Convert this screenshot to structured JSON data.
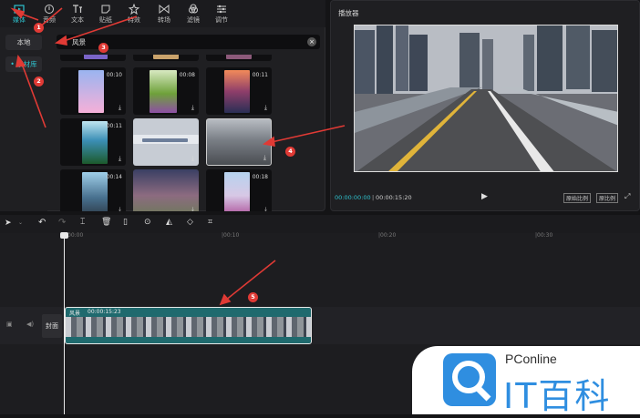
{
  "toolbar": {
    "tabs": [
      {
        "label": "媒体",
        "icon": "media-icon",
        "active": true
      },
      {
        "label": "音频",
        "icon": "audio-icon"
      },
      {
        "label": "文本",
        "icon": "text-icon"
      },
      {
        "label": "贴纸",
        "icon": "sticker-icon"
      },
      {
        "label": "特效",
        "icon": "effects-icon"
      },
      {
        "label": "转场",
        "icon": "transition-icon"
      },
      {
        "label": "滤镜",
        "icon": "filter-icon"
      },
      {
        "label": "调节",
        "icon": "adjust-icon"
      }
    ]
  },
  "sidebar": {
    "items": [
      {
        "label": "本地"
      },
      {
        "label": "• 素材库",
        "active": true
      }
    ]
  },
  "search": {
    "value": "风景"
  },
  "media_grid": {
    "durations": [
      "00:10",
      "00:08",
      "00:11",
      "00:11",
      "00:14",
      "00:18"
    ]
  },
  "player": {
    "title": "播放器",
    "current_time": "00:00:00:00",
    "total_time": "00:00:15:20",
    "btn_original": "原始比例",
    "btn_ratio": "原比例"
  },
  "timeline": {
    "ticks": [
      "|00:00",
      "|00:10",
      "|00:20",
      "|00:30"
    ],
    "cover_label": "封面",
    "clip": {
      "name": "风景",
      "duration": "00:00:15:23"
    }
  },
  "annotations": [
    "1",
    "2",
    "3",
    "4",
    "5"
  ],
  "watermark": {
    "brand": "PConline",
    "text": "IT百科"
  },
  "colors": {
    "accent": "#2fc4d0",
    "annotation": "#e03a35",
    "clip": "#1f6a6e"
  }
}
